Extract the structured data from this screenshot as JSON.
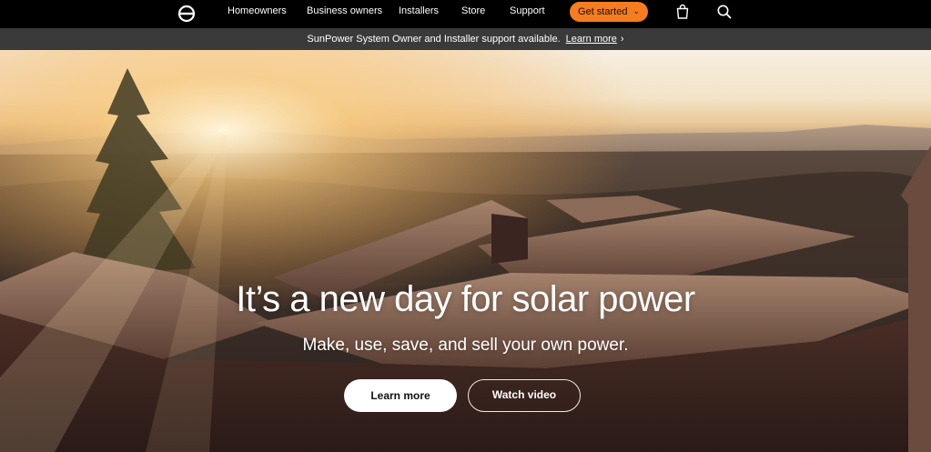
{
  "nav": {
    "logo_icon": "sunpower-logo-icon",
    "items": [
      {
        "label": "Homeowners"
      },
      {
        "label": "Business owners"
      },
      {
        "label": "Installers"
      },
      {
        "label": "Store"
      },
      {
        "label": "Support"
      }
    ],
    "cta_label": "Get started",
    "cta_icon": "chevron-down-icon",
    "cart_icon": "shopping-bag-icon",
    "search_icon": "search-icon",
    "accent_color": "#f57c1f"
  },
  "announcement": {
    "message": "SunPower System Owner and Installer support available.",
    "link_label": "Learn more",
    "arrow": "›"
  },
  "hero": {
    "title": "It’s a new day for solar power",
    "subtitle": "Make, use, save, and sell your own power.",
    "primary_button": "Learn more",
    "secondary_button": "Watch video"
  }
}
